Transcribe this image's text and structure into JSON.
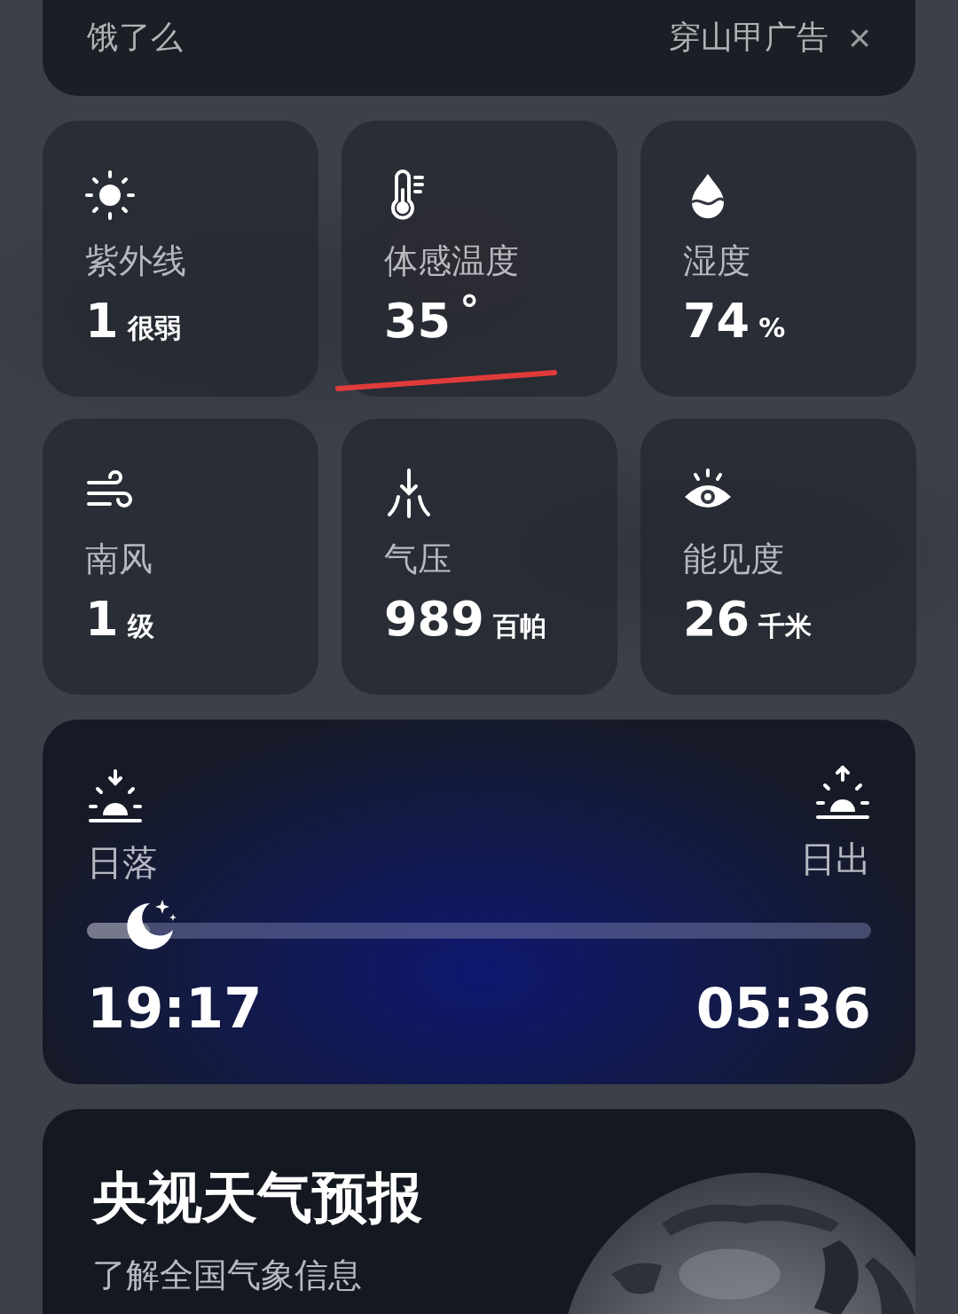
{
  "ad_banner": {
    "title": "饿了么",
    "source": "穿山甲广告",
    "close": "×"
  },
  "tiles": [
    {
      "kind": "sun",
      "label": "紫外线",
      "value": "1",
      "unit": "很弱",
      "underlined": false
    },
    {
      "kind": "thermometer",
      "label": "体感温度",
      "value": "35",
      "unit": "°",
      "underlined": true
    },
    {
      "kind": "drop",
      "label": "湿度",
      "value": "74",
      "unit": "%",
      "underlined": false
    },
    {
      "kind": "wind",
      "label": "南风",
      "value": "1",
      "unit": "级",
      "underlined": false
    },
    {
      "kind": "pressure",
      "label": "气压",
      "value": "989",
      "unit": "百帕",
      "underlined": false
    },
    {
      "kind": "eye",
      "label": "能见度",
      "value": "26",
      "unit": "千米",
      "underlined": false
    }
  ],
  "sun_card": {
    "sunset_label": "日落",
    "sunrise_label": "日出",
    "sunset_time": "19:17",
    "sunrise_time": "05:36",
    "level": 0.08
  },
  "promo": {
    "title": "央视天气预报",
    "subtitle": "了解全国气象信息"
  }
}
